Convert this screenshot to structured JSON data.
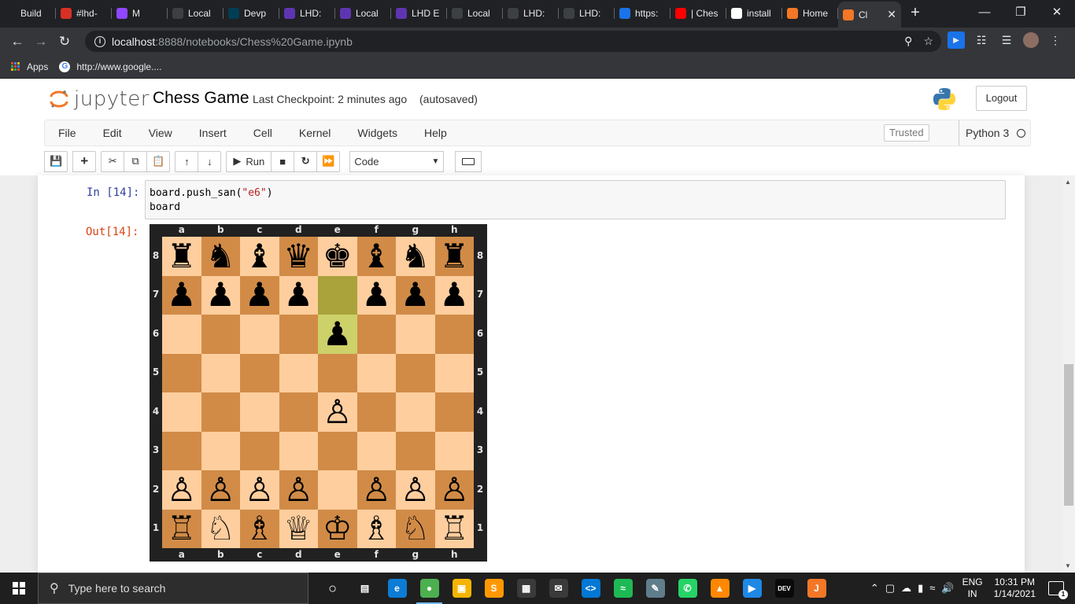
{
  "browser": {
    "tabs": [
      {
        "label": "Build",
        "icon": "github-icon",
        "color": "#202124"
      },
      {
        "label": "#lhd-",
        "icon": "calendar-icon",
        "color": "#d93025"
      },
      {
        "label": "M",
        "icon": "twitch-icon",
        "color": "#9146ff"
      },
      {
        "label": "Local",
        "icon": "jupyter-wand-icon",
        "color": "#3c4043"
      },
      {
        "label": "Devp",
        "icon": "devpost-icon",
        "color": "#003e54"
      },
      {
        "label": "LHD:",
        "icon": "list-icon",
        "color": "#5e35b1"
      },
      {
        "label": "Local",
        "icon": "list-icon",
        "color": "#5e35b1"
      },
      {
        "label": "LHD E",
        "icon": "list-icon",
        "color": "#5e35b1"
      },
      {
        "label": "Local",
        "icon": "jupyter-wand-icon",
        "color": "#3c4043"
      },
      {
        "label": "LHD:",
        "icon": "jupyter-wand-icon",
        "color": "#3c4043"
      },
      {
        "label": "LHD:",
        "icon": "jupyter-wand-icon",
        "color": "#3c4043"
      },
      {
        "label": "https:",
        "icon": "diamond-icon",
        "color": "#1a73e8"
      },
      {
        "label": "| Ches",
        "icon": "youtube-icon",
        "color": "#ff0000"
      },
      {
        "label": "install",
        "icon": "google-icon",
        "color": "#ffffff"
      },
      {
        "label": "Home",
        "icon": "jupyter-icon",
        "color": "#f37726"
      },
      {
        "label": "Cl",
        "icon": "notebook-icon",
        "color": "#f37726",
        "active": true
      }
    ],
    "new_tab": "+",
    "url_host": "localhost",
    "url_path": ":8888/notebooks/Chess%20Game.ipynb",
    "bookmarks": [
      {
        "label": "Apps",
        "icon": "apps-grid-icon"
      },
      {
        "label": "http://www.google....",
        "icon": "google-icon"
      }
    ]
  },
  "jupyter": {
    "logo_text": "jupyter",
    "notebook_name": "Chess Game",
    "checkpoint": "Last Checkpoint: 2 minutes ago",
    "autosave": "(autosaved)",
    "logout": "Logout",
    "menu": [
      "File",
      "Edit",
      "View",
      "Insert",
      "Cell",
      "Kernel",
      "Widgets",
      "Help"
    ],
    "trusted": "Trusted",
    "kernel": "Python 3",
    "run_label": "Run",
    "cell_type": "Code"
  },
  "cell": {
    "in_prompt": "In [14]:",
    "out_prompt": "Out[14]:",
    "code_line1_fn": "board.push_san(",
    "code_line1_arg": "\"e6\"",
    "code_line1_end": ")",
    "code_line2": "board"
  },
  "chess": {
    "files": [
      "a",
      "b",
      "c",
      "d",
      "e",
      "f",
      "g",
      "h"
    ],
    "ranks": [
      "8",
      "7",
      "6",
      "5",
      "4",
      "3",
      "2",
      "1"
    ],
    "light_color": "#ffce9e",
    "dark_color": "#d18b47",
    "highlight_light": "#cdd16a",
    "highlight_dark": "#aaa23b",
    "highlight_squares": [
      "e7",
      "e6"
    ],
    "position": [
      [
        "♜",
        "♞",
        "♝",
        "♛",
        "♚",
        "♝",
        "♞",
        "♜"
      ],
      [
        "♟",
        "♟",
        "♟",
        "♟",
        "",
        "♟",
        "♟",
        "♟"
      ],
      [
        "",
        "",
        "",
        "",
        "♟",
        "",
        "",
        ""
      ],
      [
        "",
        "",
        "",
        "",
        "",
        "",
        "",
        ""
      ],
      [
        "",
        "",
        "",
        "",
        "♙",
        "",
        "",
        ""
      ],
      [
        "",
        "",
        "",
        "",
        "",
        "",
        "",
        ""
      ],
      [
        "♙",
        "♙",
        "♙",
        "♙",
        "",
        "♙",
        "♙",
        "♙"
      ],
      [
        "♖",
        "♘",
        "♗",
        "♕",
        "♔",
        "♗",
        "♘",
        "♖"
      ]
    ]
  },
  "taskbar": {
    "search_placeholder": "Type here to search",
    "lang_top": "ENG",
    "lang_bottom": "IN",
    "time": "10:31 PM",
    "date": "1/14/2021",
    "notifications": "1",
    "apps": [
      {
        "name": "task-view-icon",
        "color": "#1f1f1f"
      },
      {
        "name": "edge-icon",
        "color": "#0c7cd5"
      },
      {
        "name": "chrome-icon",
        "color": "#4caf50",
        "active": true
      },
      {
        "name": "file-explorer-icon",
        "color": "#f4b400"
      },
      {
        "name": "sublime-icon",
        "color": "#ff9800"
      },
      {
        "name": "store-icon",
        "color": "#3a3a3a"
      },
      {
        "name": "mail-icon",
        "color": "#3a3a3a"
      },
      {
        "name": "vscode-icon",
        "color": "#0078d4"
      },
      {
        "name": "spotify-icon",
        "color": "#1db954"
      },
      {
        "name": "notes-icon",
        "color": "#607d8b"
      },
      {
        "name": "whatsapp-icon",
        "color": "#25d366"
      },
      {
        "name": "vlc-icon",
        "color": "#ff8800"
      },
      {
        "name": "connect-icon",
        "color": "#1e88e5"
      },
      {
        "name": "dev-icon",
        "color": "#0a0a0a"
      },
      {
        "name": "jupyter-icon",
        "color": "#f37726"
      }
    ]
  }
}
